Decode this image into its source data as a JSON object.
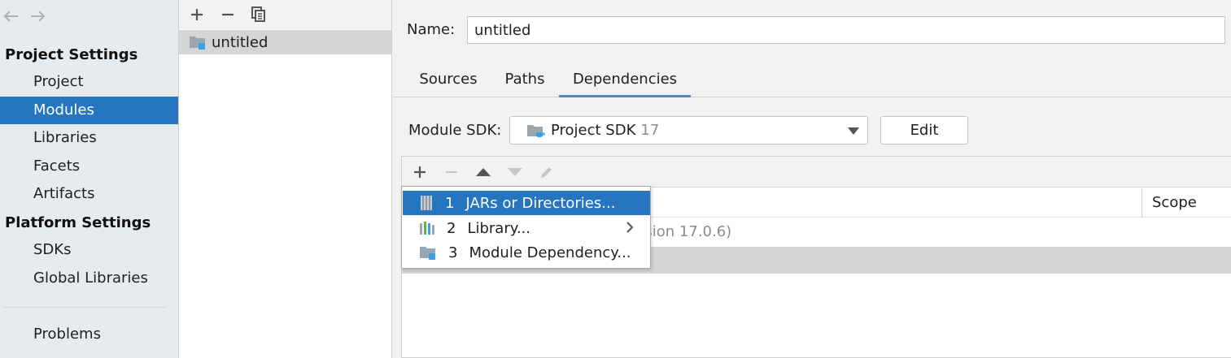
{
  "sidebar": {
    "back_icon": "back-arrow-icon",
    "forward_icon": "forward-arrow-icon",
    "project_settings_header": "Project Settings",
    "project_items": [
      {
        "label": "Project",
        "selected": false
      },
      {
        "label": "Modules",
        "selected": true
      },
      {
        "label": "Libraries",
        "selected": false
      },
      {
        "label": "Facets",
        "selected": false
      },
      {
        "label": "Artifacts",
        "selected": false
      }
    ],
    "platform_settings_header": "Platform Settings",
    "platform_items": [
      {
        "label": "SDKs"
      },
      {
        "label": "Global Libraries"
      }
    ],
    "problems_label": "Problems"
  },
  "modules_panel": {
    "toolbar": {
      "add_icon": "plus-icon",
      "remove_icon": "minus-icon",
      "copy_icon": "copy-icon"
    },
    "items": [
      {
        "label": "untitled",
        "icon": "module-folder-icon",
        "selected": true
      }
    ]
  },
  "content": {
    "name_label": "Name:",
    "name_value": "untitled",
    "tabs": [
      {
        "label": "Sources",
        "active": false
      },
      {
        "label": "Paths",
        "active": false
      },
      {
        "label": "Dependencies",
        "active": true
      }
    ],
    "module_sdk_label": "Module SDK:",
    "module_sdk_value": "Project SDK",
    "module_sdk_version": "17",
    "edit_button": "Edit",
    "dependencies": {
      "column_scope": "Scope",
      "row_partial_text": "rsion 17.0.6)"
    }
  },
  "popup_menu": {
    "items": [
      {
        "number": "1",
        "label": "JARs or Directories...",
        "icon": "jar-directory-icon",
        "highlighted": true
      },
      {
        "number": "2",
        "label": "Library...",
        "icon": "library-icon",
        "submenu": true
      },
      {
        "number": "3",
        "label": "Module Dependency...",
        "icon": "module-folder-icon"
      }
    ]
  },
  "colors": {
    "selection": "#2675bf",
    "sidebar_bg": "#e6ebf0",
    "tab_underline": "#4a88c7",
    "module_icon_accent": "#3ba0e0"
  }
}
